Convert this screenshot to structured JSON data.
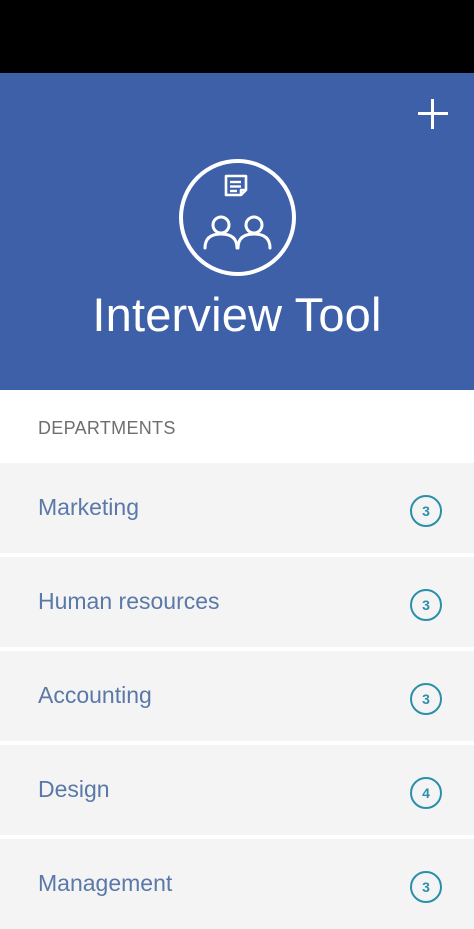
{
  "header": {
    "title": "Interview Tool",
    "add_icon": "plus-icon",
    "logo_icon": "interview-people-document-icon",
    "background_color": "#3d60a8"
  },
  "section": {
    "title": "DEPARTMENTS"
  },
  "departments": [
    {
      "name": "Marketing",
      "count": "3"
    },
    {
      "name": "Human resources",
      "count": "3"
    },
    {
      "name": "Accounting",
      "count": "3"
    },
    {
      "name": "Design",
      "count": "4"
    },
    {
      "name": "Management",
      "count": "3"
    }
  ],
  "colors": {
    "item_text": "#5a78a8",
    "badge": "#2a8fa8",
    "item_background": "#f4f4f4"
  }
}
